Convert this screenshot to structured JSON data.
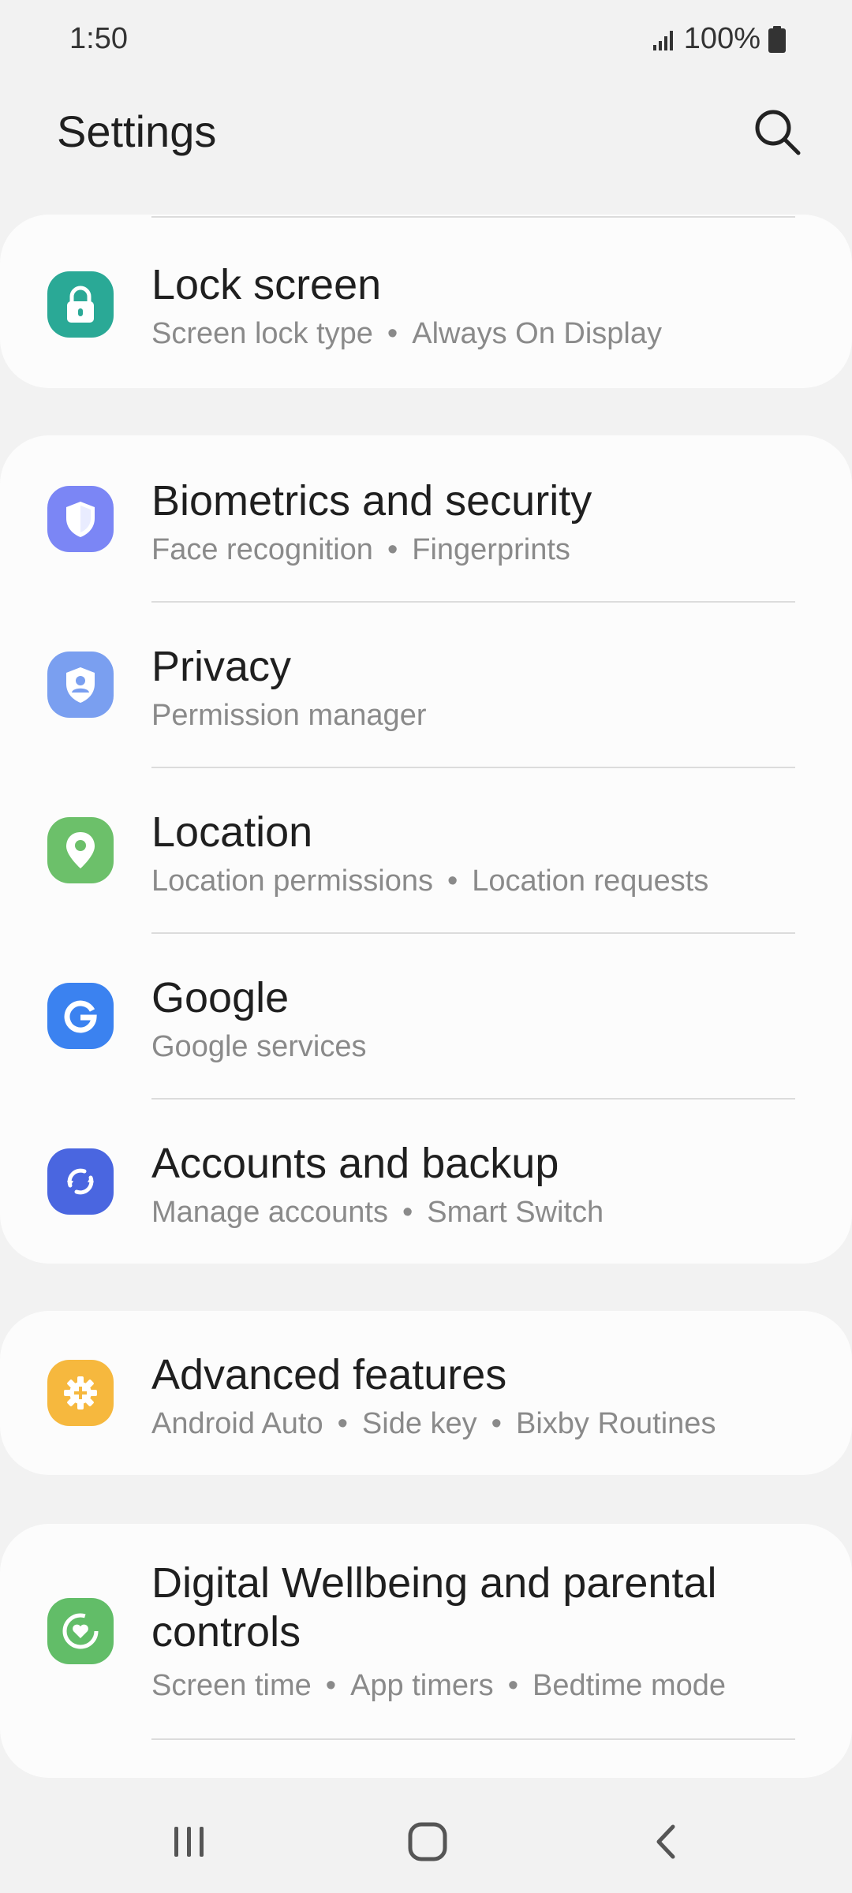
{
  "status_bar": {
    "time": "1:50",
    "battery": "100%"
  },
  "header": {
    "title": "Settings"
  },
  "colors": {
    "lock_screen": "#2aa996",
    "biometrics": "#7b86f5",
    "privacy": "#7a9ff0",
    "location": "#6cc06a",
    "google": "#3b82f0",
    "accounts": "#4a66e0",
    "advanced": "#f6b83e",
    "wellbeing": "#62bd68"
  },
  "items": {
    "lock_screen": {
      "title": "Lock screen",
      "sub": [
        "Screen lock type",
        "Always On Display"
      ],
      "icon": "lock-icon"
    },
    "biometrics": {
      "title": "Biometrics and security",
      "sub": [
        "Face recognition",
        "Fingerprints"
      ],
      "icon": "shield-icon"
    },
    "privacy": {
      "title": "Privacy",
      "sub": [
        "Permission manager"
      ],
      "icon": "privacy-shield-icon"
    },
    "location": {
      "title": "Location",
      "sub": [
        "Location permissions",
        "Location requests"
      ],
      "icon": "location-pin-icon"
    },
    "google": {
      "title": "Google",
      "sub": [
        "Google services"
      ],
      "icon": "google-g-icon"
    },
    "accounts": {
      "title": "Accounts and backup",
      "sub": [
        "Manage accounts",
        "Smart Switch"
      ],
      "icon": "sync-icon"
    },
    "advanced": {
      "title": "Advanced features",
      "sub": [
        "Android Auto",
        "Side key",
        "Bixby Routines"
      ],
      "icon": "gear-plus-icon"
    },
    "wellbeing": {
      "title": "Digital Wellbeing and parental controls",
      "sub": [
        "Screen time",
        "App timers",
        "Bedtime mode"
      ],
      "icon": "heart-ring-icon"
    }
  },
  "separator": "•"
}
